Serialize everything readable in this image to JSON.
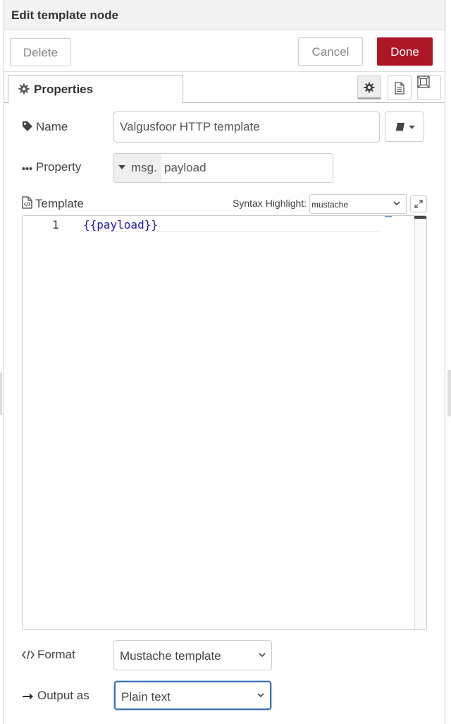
{
  "header": {
    "title": "Edit template node"
  },
  "toolbar": {
    "delete_label": "Delete",
    "cancel_label": "Cancel",
    "done_label": "Done"
  },
  "tabs": {
    "properties_label": "Properties"
  },
  "form": {
    "name": {
      "label": "Name",
      "value": "Valgusfoor HTTP template"
    },
    "property": {
      "label": "Property",
      "type": "msg.",
      "value": "payload"
    },
    "template": {
      "label": "Template",
      "syntax_label": "Syntax Highlight:",
      "syntax_value": "mustache",
      "line_number": "1",
      "code": "{{payload}}"
    },
    "format": {
      "label": "Format",
      "value": "Mustache template"
    },
    "output": {
      "label": "Output as",
      "value": "Plain text"
    }
  },
  "colors": {
    "accent": "#ad1625",
    "focus": "#3b73b9",
    "code": "#1a1aa6"
  },
  "icons": [
    "gear-icon",
    "file-icon",
    "frame-icon",
    "tag-icon",
    "ellipsis-icon",
    "file-code-icon",
    "expand-icon",
    "book-icon",
    "code-icon",
    "arrow-right-icon",
    "chevron-down-icon"
  ]
}
